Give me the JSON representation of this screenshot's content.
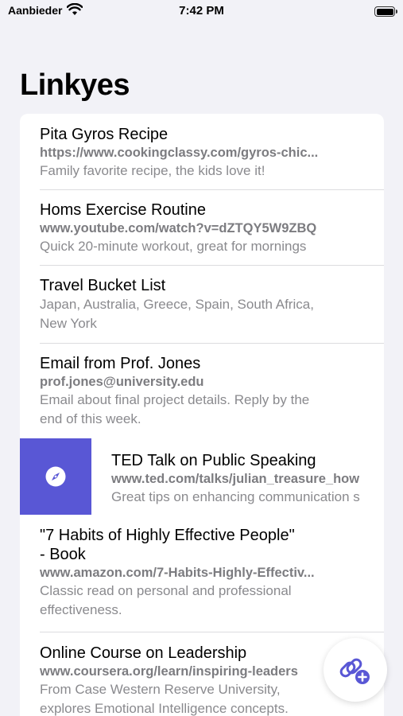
{
  "status_bar": {
    "carrier": "Aanbieder",
    "time": "7:42 PM"
  },
  "title": "Linkyes",
  "colors": {
    "accent": "#5957d5",
    "background": "#f2f2f7"
  },
  "items": [
    {
      "title": "Pita Gyros Recipe",
      "url": "https://www.cookingclassy.com/gyros-chic...",
      "note": "Family favorite recipe, the kids love it!"
    },
    {
      "title": "Homs Exercise Routine",
      "url": "www.youtube.com/watch?v=dZTQY5W9ZBQ",
      "note": "Quick 20-minute workout, great for mornings"
    },
    {
      "title": "Travel Bucket List",
      "note_line1": "Japan, Australia, Greece, Spain, South Africa,",
      "note_line2": "New York"
    },
    {
      "title": "Email from Prof. Jones",
      "url": "prof.jones@university.edu",
      "note_line1": "Email about final project details. Reply by the",
      "note_line2": "end of this week."
    },
    {
      "title": "TED Talk on Public Speaking",
      "url": "www.ted.com/talks/julian_treasure_how",
      "note": "Great tips on enhancing communication s",
      "swipe_action_icon": "compass-icon"
    },
    {
      "title_line1": "\"7 Habits of Highly Effective People\"",
      "title_line2": "- Book",
      "url": "www.amazon.com/7-Habits-Highly-Effectiv...",
      "note_line1": "Classic read on personal and professional",
      "note_line2": "effectiveness."
    },
    {
      "title": "Online Course on Leadership",
      "url": "www.coursera.org/learn/inspiring-leaders",
      "note_line1": "From Case Western Reserve University,",
      "note_line2": "explores Emotional Intelligence concepts."
    }
  ],
  "fab": {
    "icon": "add-link-icon"
  }
}
